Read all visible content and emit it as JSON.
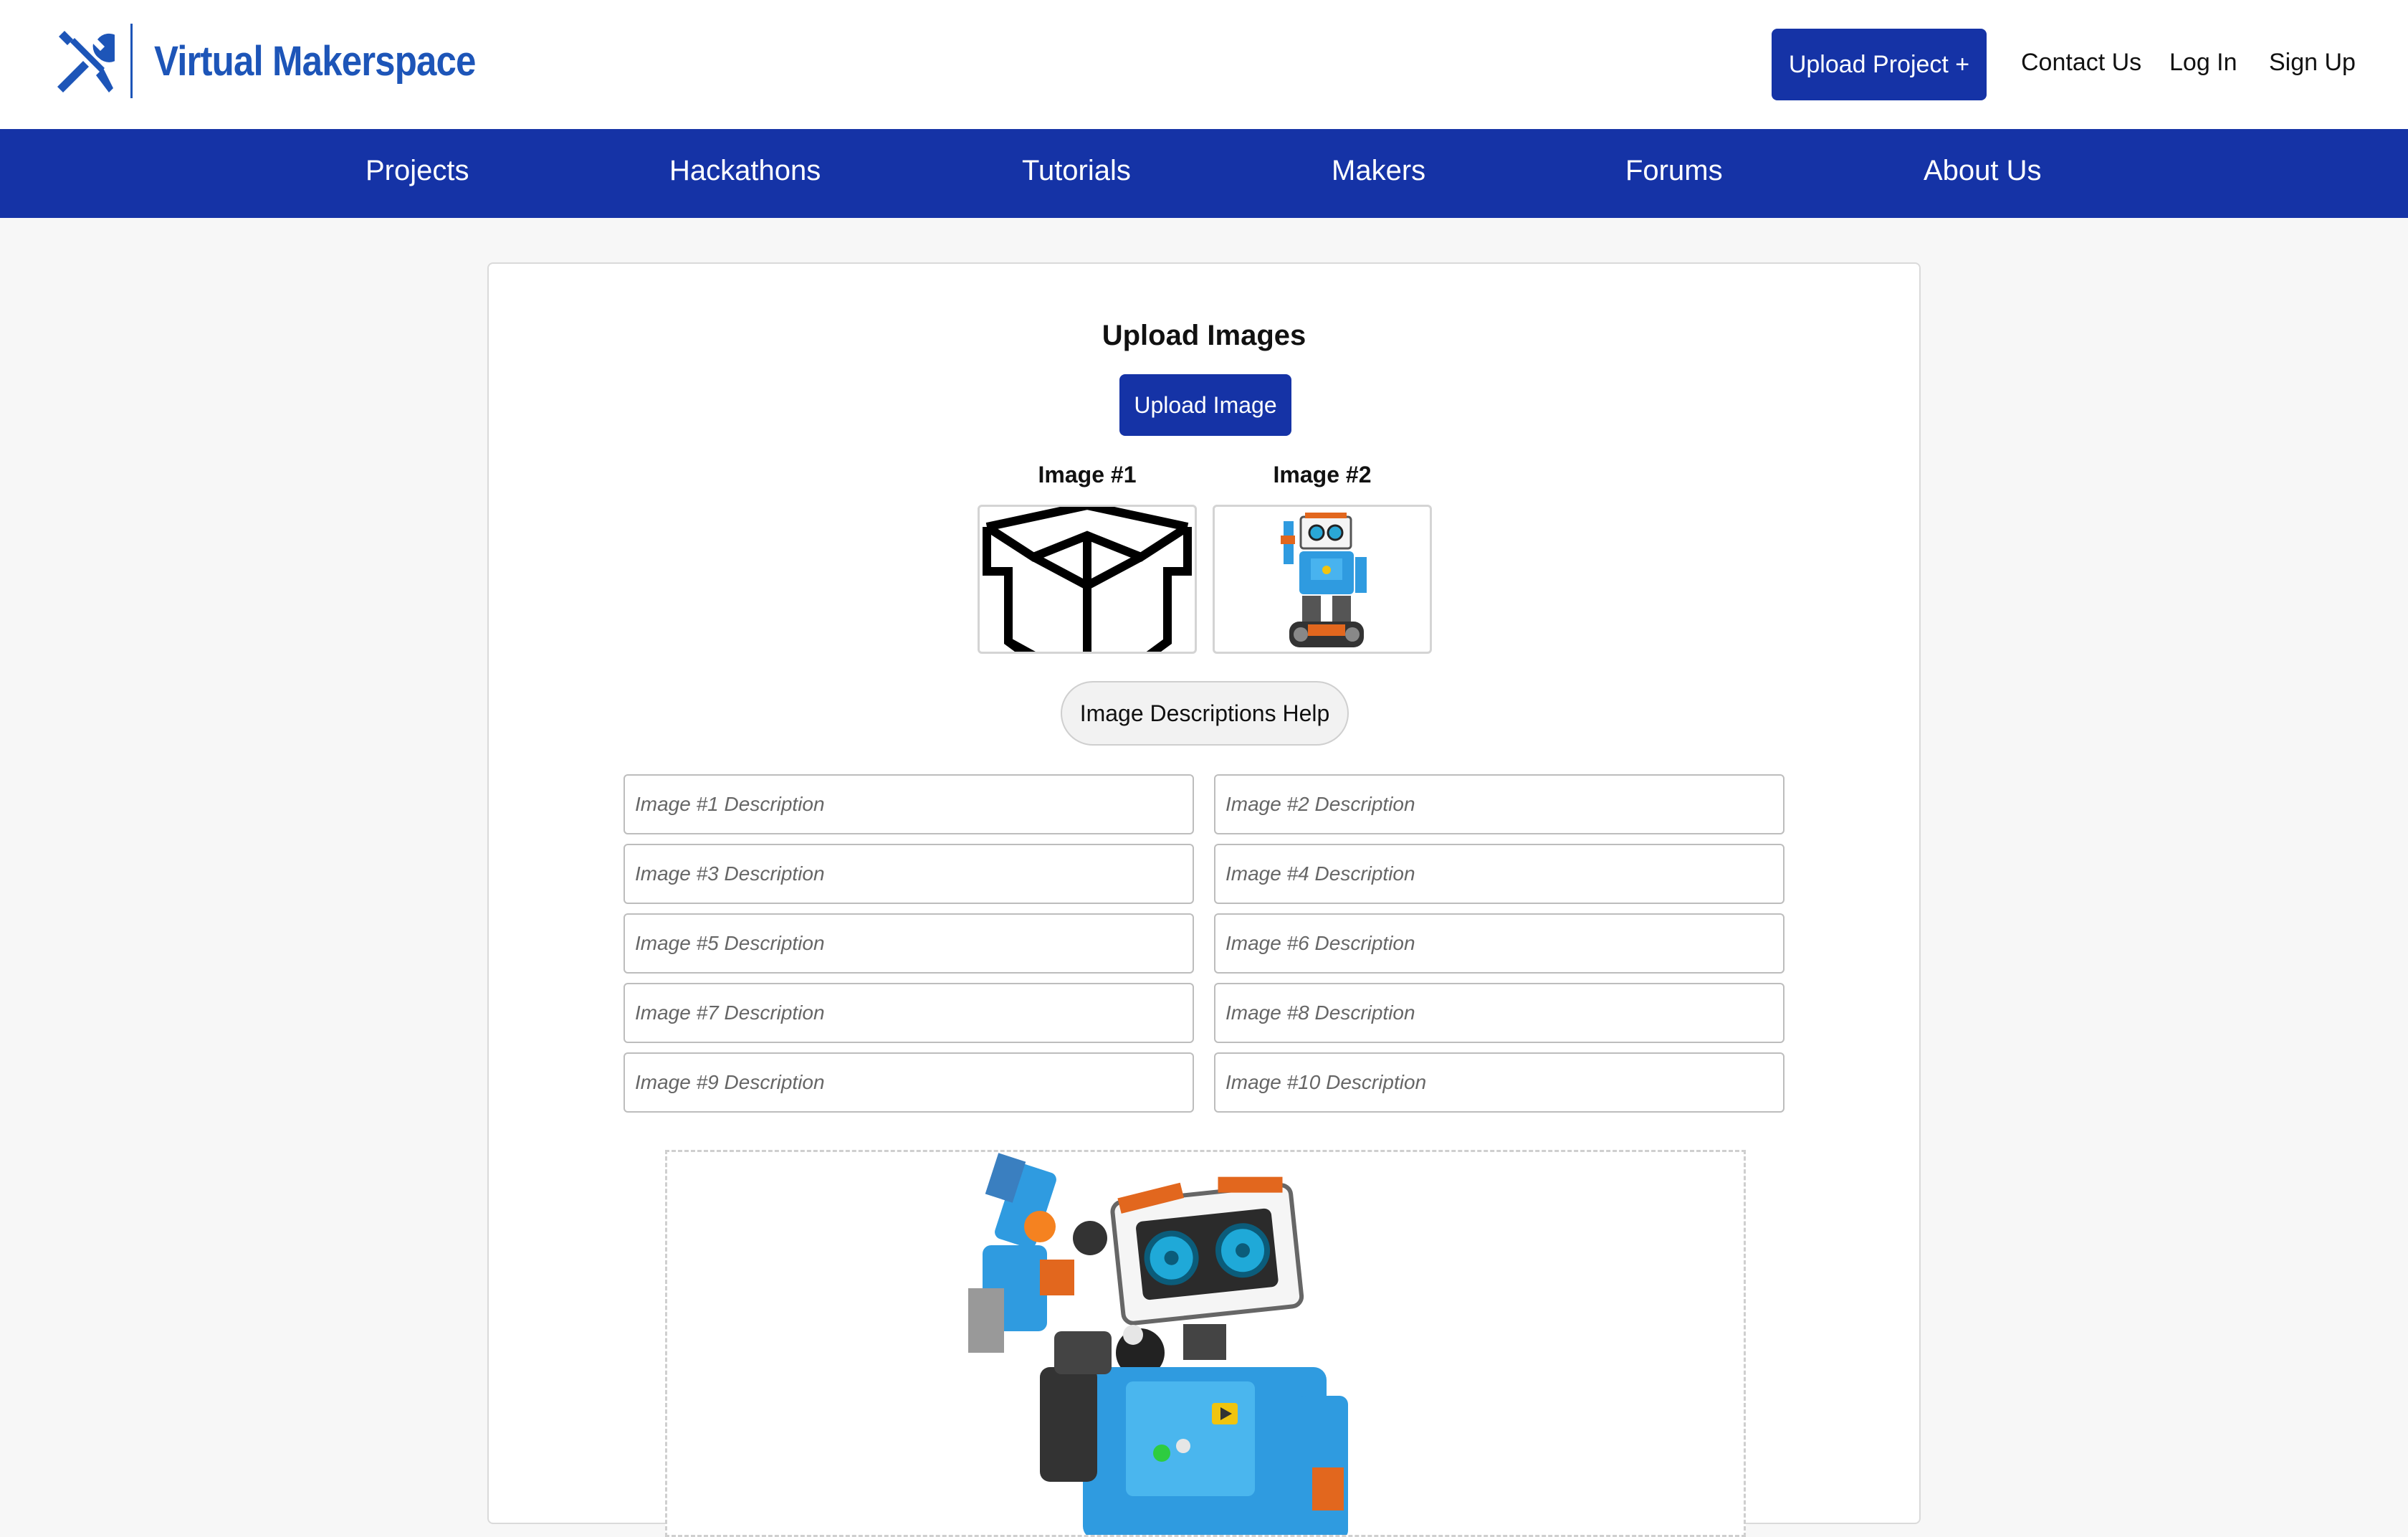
{
  "brand": {
    "name": "Virtual Makerspace",
    "color": "#1d55b8",
    "logo_icon": "wrench-screwdriver-icon"
  },
  "header": {
    "upload_project_label": "Upload Project +",
    "contact_label": "Contact Us",
    "login_label": "Log In",
    "signup_label": "Sign Up"
  },
  "nav": {
    "color": "#1533a6",
    "items": [
      "Projects",
      "Hackathons",
      "Tutorials",
      "Makers",
      "Forums",
      "About Us"
    ]
  },
  "upload": {
    "title": "Upload Images",
    "upload_button_label": "Upload Image",
    "images": [
      {
        "label": "Image #1",
        "icon": "open-box-icon"
      },
      {
        "label": "Image #2",
        "icon": "robot-photo"
      }
    ],
    "help_button_label": "Image Descriptions Help",
    "description_placeholders": [
      "Image #1 Description",
      "Image #2 Description",
      "Image #3 Description",
      "Image #4 Description",
      "Image #5 Description",
      "Image #6 Description",
      "Image #7 Description",
      "Image #8 Description",
      "Image #9 Description",
      "Image #10 Description"
    ],
    "preview_icon": "robot-photo"
  }
}
